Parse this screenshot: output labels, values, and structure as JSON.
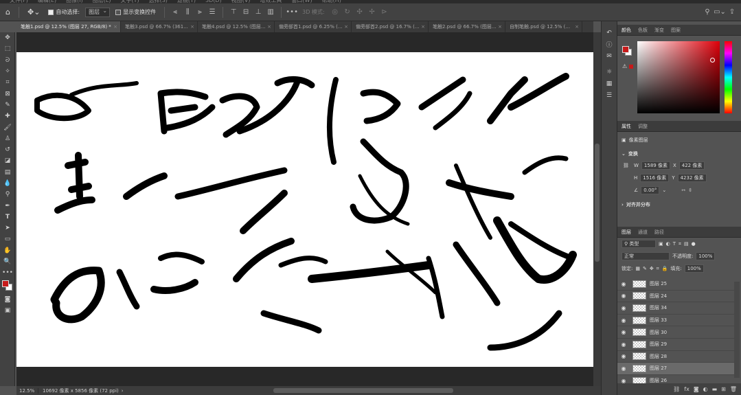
{
  "menu": [
    "文件(F)",
    "编辑(E)",
    "图像(I)",
    "图层(L)",
    "文字(Y)",
    "选择(S)",
    "滤镜(T)",
    "3D(D)",
    "视图(V)",
    "增效工具",
    "窗口(W)",
    "帮助(H)"
  ],
  "options": {
    "auto_select_label": "自动选择:",
    "auto_select_value": "图层",
    "show_transform_label": "显示变换控件",
    "mode_3d_label": "3D 模式:"
  },
  "tabs": [
    {
      "label": "笔触1.psd @ 12.5% (图层 27, RGB/8) *",
      "active": true
    },
    {
      "label": "笔触3.psd @ 66.7% (361...",
      "active": false
    },
    {
      "label": "笔触4.psd @ 12.5% (图层...",
      "active": false
    },
    {
      "label": "偏旁部首1.psd @ 6.25% (...",
      "active": false
    },
    {
      "label": "偏旁部首2.psd @ 16.7% (...",
      "active": false
    },
    {
      "label": "笔触2.psd @ 66.7% (图层...",
      "active": false
    },
    {
      "label": "自制笔触.psd @ 12.5% (...",
      "active": false
    }
  ],
  "status": {
    "zoom": "12.5%",
    "doc_info": "10692 像素 x 5856 像素 (72 ppi)"
  },
  "colors": {
    "foreground": "#c61a1a",
    "background": "#ffffff"
  },
  "color_panel": {
    "tabs": [
      "颜色",
      "色板",
      "渐变",
      "图案"
    ]
  },
  "properties": {
    "tabs": [
      "属性",
      "调整"
    ],
    "kind": "像素图层",
    "transform_title": "变换",
    "w_label": "W",
    "w_value": "1589 像素",
    "x_label": "X",
    "x_value": "422 像素",
    "h_label": "H",
    "h_value": "1516 像素",
    "y_label": "Y",
    "y_value": "4232 像素",
    "angle_value": "0.00°",
    "align_title": "对齐并分布"
  },
  "layers": {
    "tabs": [
      "图层",
      "通道",
      "路径"
    ],
    "filter_label": "类型",
    "blend_mode": "正常",
    "opacity_label": "不透明度:",
    "opacity_value": "100%",
    "lock_label": "锁定:",
    "fill_label": "填充:",
    "fill_value": "100%",
    "items": [
      {
        "name": "图层 25",
        "active": false
      },
      {
        "name": "图层 24",
        "active": false
      },
      {
        "name": "图层 34",
        "active": false
      },
      {
        "name": "图层 33",
        "active": false
      },
      {
        "name": "图层 30",
        "active": false
      },
      {
        "name": "图层 29",
        "active": false
      },
      {
        "name": "图层 28",
        "active": false
      },
      {
        "name": "图层 27",
        "active": true
      },
      {
        "name": "图层 26",
        "active": false
      }
    ]
  }
}
